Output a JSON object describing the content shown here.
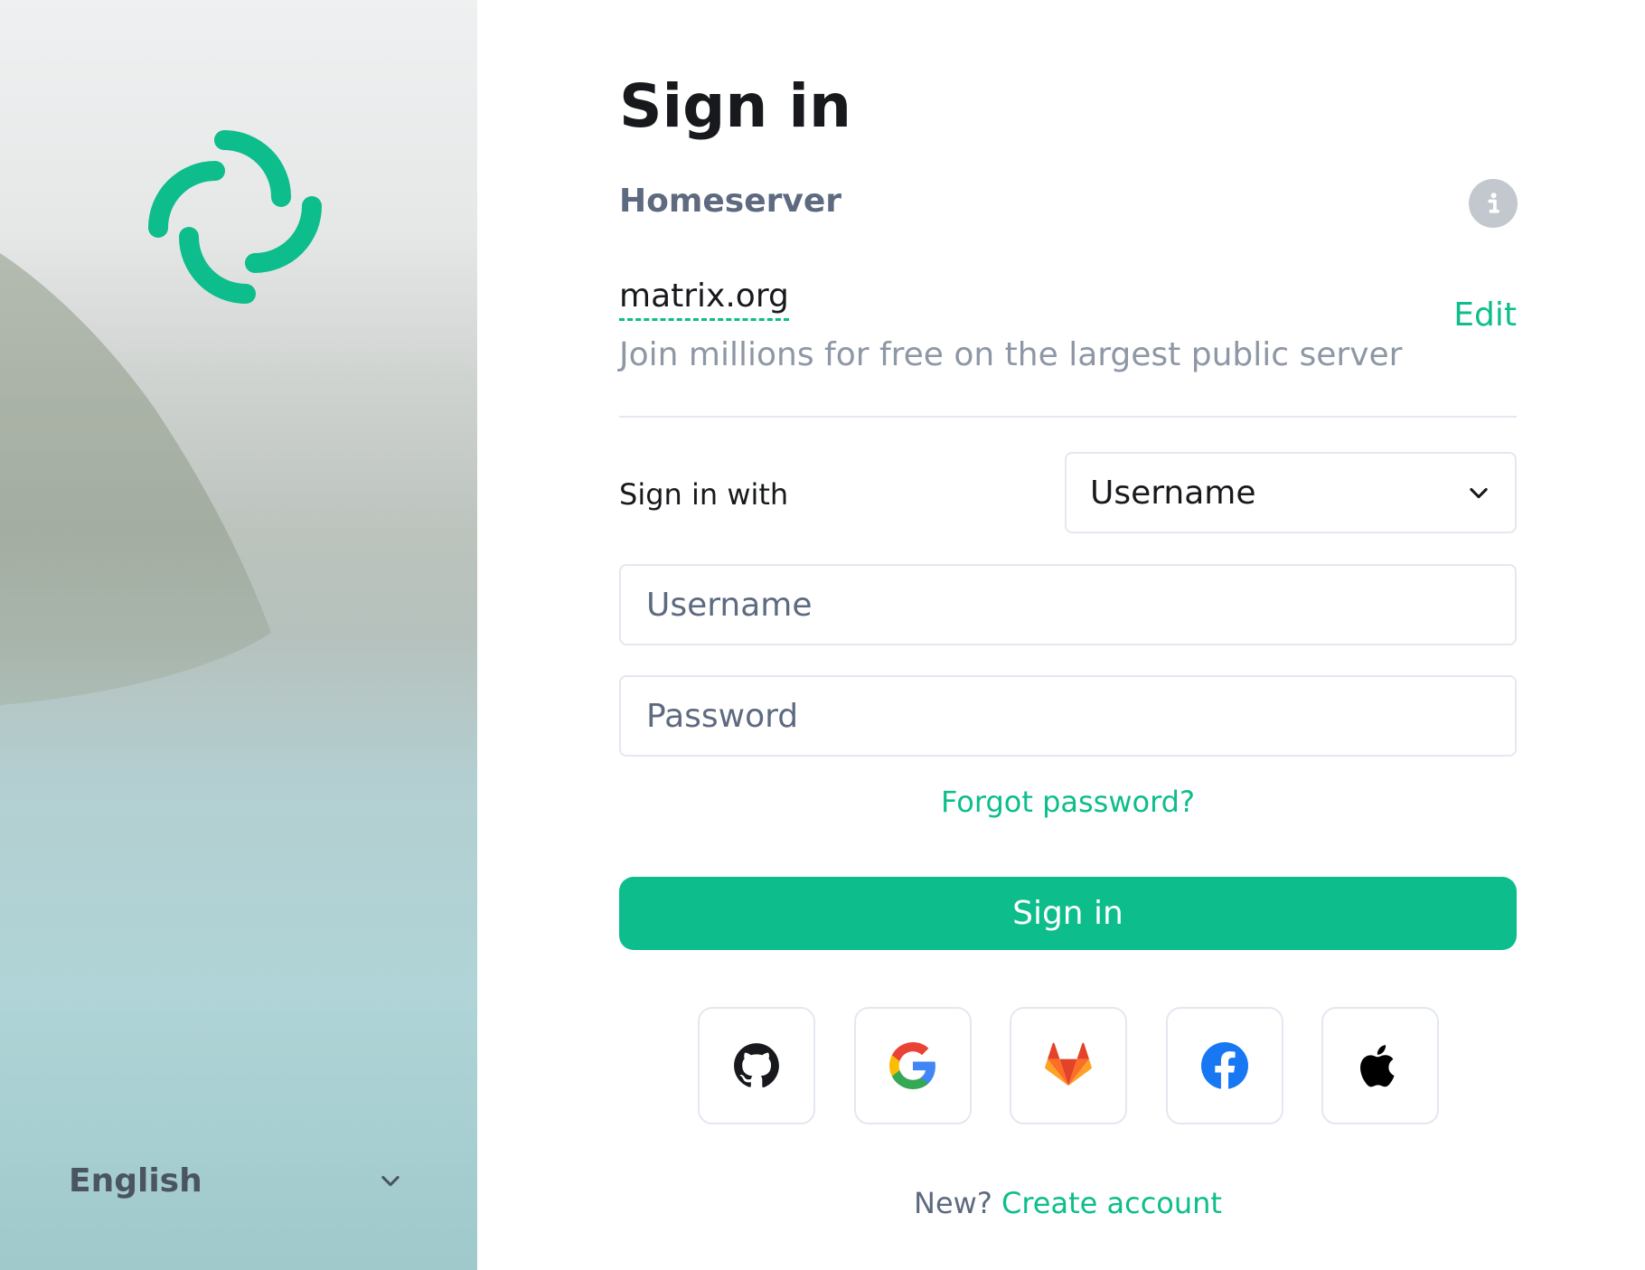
{
  "colors": {
    "accent": "#0dbd8b",
    "text": "#17191c",
    "muted": "#8d97a5",
    "secondary": "#5d6a80",
    "border": "#e3e8f0"
  },
  "left": {
    "language": "English",
    "language_icon": "chevron-down-icon",
    "logo_icon": "element-logo-icon"
  },
  "title": "Sign in",
  "homeserver": {
    "label": "Homeserver",
    "info_icon": "info-icon",
    "name": "matrix.org",
    "edit_label": "Edit",
    "description": "Join millions for free on the largest public server"
  },
  "form": {
    "signin_with_label": "Sign in with",
    "login_type": "Username",
    "username_placeholder": "Username",
    "password_placeholder": "Password",
    "forgot_label": "Forgot password?",
    "submit_label": "Sign in"
  },
  "sso": [
    {
      "name": "GitHub",
      "icon": "github-icon"
    },
    {
      "name": "Google",
      "icon": "google-icon"
    },
    {
      "name": "GitLab",
      "icon": "gitlab-icon"
    },
    {
      "name": "Facebook",
      "icon": "facebook-icon"
    },
    {
      "name": "Apple",
      "icon": "apple-icon"
    }
  ],
  "footer": {
    "new_label": "New?",
    "create_label": "Create account"
  }
}
